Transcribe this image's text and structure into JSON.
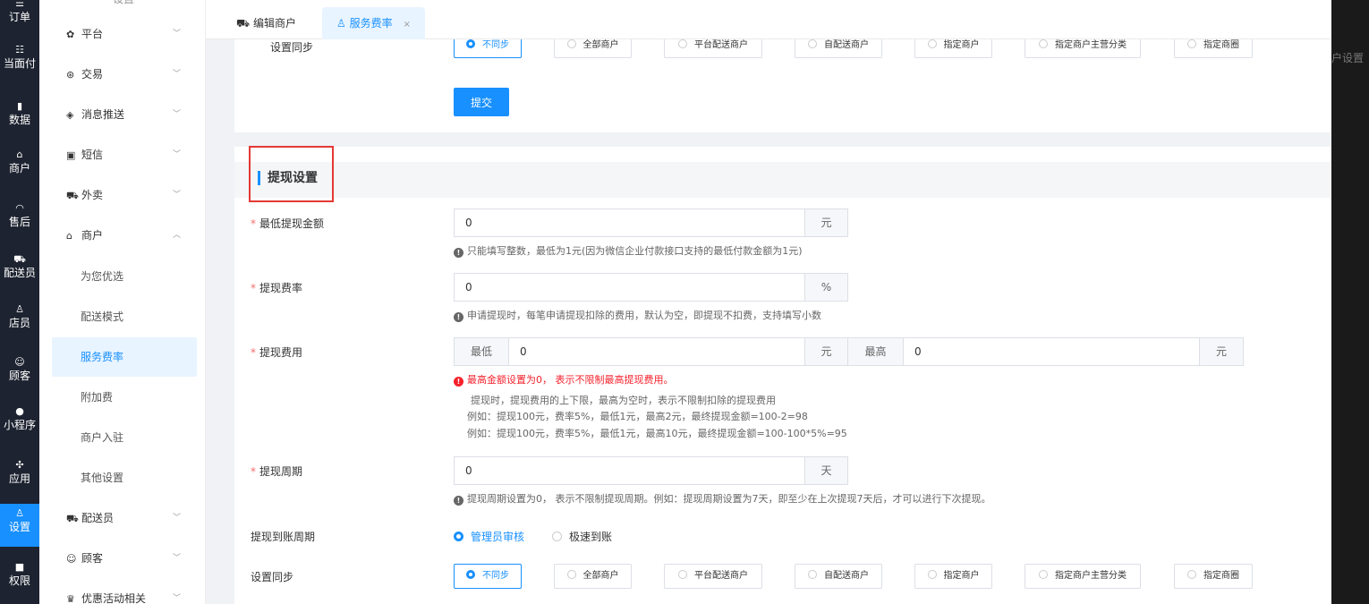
{
  "rail": [
    {
      "icon": "☰",
      "label": "订单",
      "name": "rail-orders"
    },
    {
      "icon": "☷",
      "label": "当面付",
      "name": "rail-facepay"
    },
    {
      "icon": "▮",
      "label": "数据",
      "name": "rail-data"
    },
    {
      "icon": "⌂",
      "label": "商户",
      "name": "rail-merchant"
    },
    {
      "icon": "◠",
      "label": "售后",
      "name": "rail-aftersale"
    },
    {
      "icon": "⛟",
      "label": "配送员",
      "name": "rail-courier"
    },
    {
      "icon": "♙",
      "label": "店员",
      "name": "rail-clerk"
    },
    {
      "icon": "☺",
      "label": "顾客",
      "name": "rail-customer"
    },
    {
      "icon": "●",
      "label": "小程序",
      "name": "rail-miniapp"
    },
    {
      "icon": "✣",
      "label": "应用",
      "name": "rail-apps"
    },
    {
      "icon": "♙",
      "label": "设置",
      "name": "rail-settings"
    },
    {
      "icon": "■",
      "label": "权限",
      "name": "rail-permissions"
    }
  ],
  "menu": {
    "top_partial": "设置",
    "groups": [
      {
        "icon": "✿",
        "label": "平台"
      },
      {
        "icon": "⊛",
        "label": "交易"
      },
      {
        "icon": "◈",
        "label": "消息推送"
      },
      {
        "icon": "▣",
        "label": "短信"
      },
      {
        "icon": "⛟",
        "label": "外卖"
      },
      {
        "icon": "⌂",
        "label": "商户"
      }
    ],
    "sub": [
      "为您优选",
      "配送模式",
      "服务费率",
      "附加费",
      "商户入驻",
      "其他设置"
    ],
    "after": [
      {
        "icon": "⛟",
        "label": "配送员"
      },
      {
        "icon": "☺",
        "label": "顾客"
      },
      {
        "icon": "♛",
        "label": "优惠活动相关"
      }
    ]
  },
  "tabs": [
    {
      "icon": "⛟",
      "label": "编辑商户"
    },
    {
      "icon": "♙",
      "label": "服务费率",
      "close": "×"
    }
  ],
  "top": {
    "sync_label": "设置同步",
    "submit": "提交"
  },
  "sync_options": [
    "不同步",
    "全部商户",
    "平台配送商户",
    "自配送商户",
    "指定商户",
    "指定商户主营分类",
    "指定商圈"
  ],
  "withdraw": {
    "title": "提现设置",
    "min_amount": {
      "label": "最低提现金额",
      "value": "0",
      "unit": "元",
      "hint": "只能填写整数，最低为1元(因为微信企业付款接口支持的最低付款金额为1元)"
    },
    "rate": {
      "label": "提现费率",
      "value": "0",
      "unit": "%",
      "hint": "申请提现时，每笔申请提现扣除的费用，默认为空，即提现不扣费，支持填写小数"
    },
    "fee": {
      "label": "提现费用",
      "min_label": "最低",
      "min_value": "0",
      "min_unit": "元",
      "max_label": "最高",
      "max_value": "0",
      "max_unit": "元",
      "warn": "最高金额设置为0， 表示不限制最高提现费用。",
      "line1": "提现时，提现费用的上下限，最高为空时，表示不限制扣除的提现费用",
      "line2": "例如：提现100元，费率5%，最低1元，最高2元，最终提现金额=100-2=98",
      "line3": "例如：提现100元，费率5%，最低1元，最高10元，最终提现金额=100-100*5%=95"
    },
    "period": {
      "label": "提现周期",
      "value": "0",
      "unit": "天",
      "hint": "提现周期设置为0， 表示不限制提现周期。例如：提现周期设置为7天，即至少在上次提现7天后，才可以进行下次提现。"
    },
    "arrival": {
      "label": "提现到账周期",
      "options": [
        "管理员审核",
        "极速到账"
      ]
    },
    "sync_label": "设置同步"
  },
  "cut_right_text": "户设置"
}
